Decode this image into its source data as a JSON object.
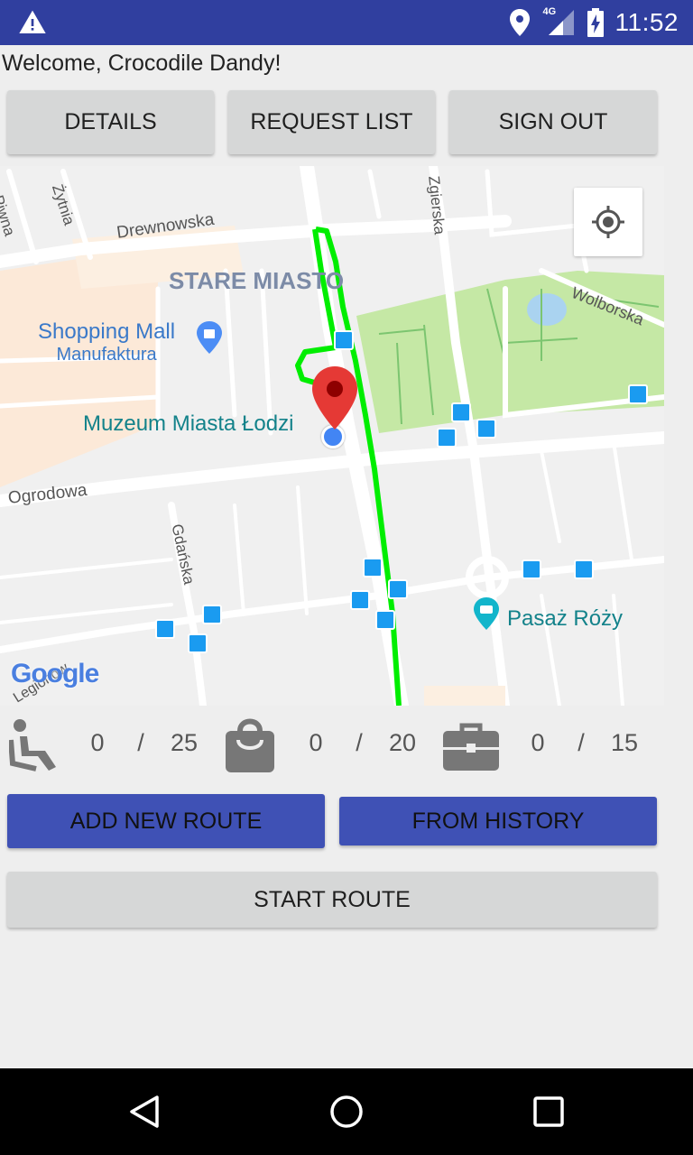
{
  "status_bar": {
    "time": "11:52",
    "network": "4G",
    "icons": [
      "warning-icon",
      "location-icon",
      "signal-icon",
      "battery-charging-icon"
    ]
  },
  "welcome_text": "Welcome, Crocodile Dandy!",
  "top_buttons": {
    "details": "DETAILS",
    "request_list": "REQUEST LIST",
    "sign_out": "SIGN OUT"
  },
  "map": {
    "district": "STARE MIASTO",
    "streets": [
      "Drewnowska",
      "Piwna",
      "Żytnia",
      "Zgierska",
      "Wolborska",
      "Ogrodowa",
      "Gdańska",
      "Legionów"
    ],
    "places": [
      {
        "line1": "Shopping Mall",
        "line2": "Manufaktura"
      },
      {
        "line1": "Muzeum Miasta Łodzi"
      },
      {
        "line1": "Pasaż Róży"
      }
    ],
    "logo": "Google",
    "colors": {
      "route": "#00ee00",
      "park": "#c5e8a5",
      "water": "#aad3f0",
      "marker": "#e53935",
      "user_dot": "#4285f4"
    }
  },
  "capacity": {
    "wheelchair": {
      "current": "0",
      "separator": "/",
      "max": "25"
    },
    "luggage": {
      "current": "0",
      "separator": "/",
      "max": "20"
    },
    "briefcase": {
      "current": "0",
      "separator": "/",
      "max": "15"
    }
  },
  "route_buttons": {
    "add_new_route": "ADD NEW ROUTE",
    "from_history": "FROM HISTORY",
    "start_route": "START ROUTE"
  },
  "colors": {
    "primary": "#3f51b5",
    "status_bar": "#303f9f",
    "button_gray": "#d6d7d7"
  }
}
